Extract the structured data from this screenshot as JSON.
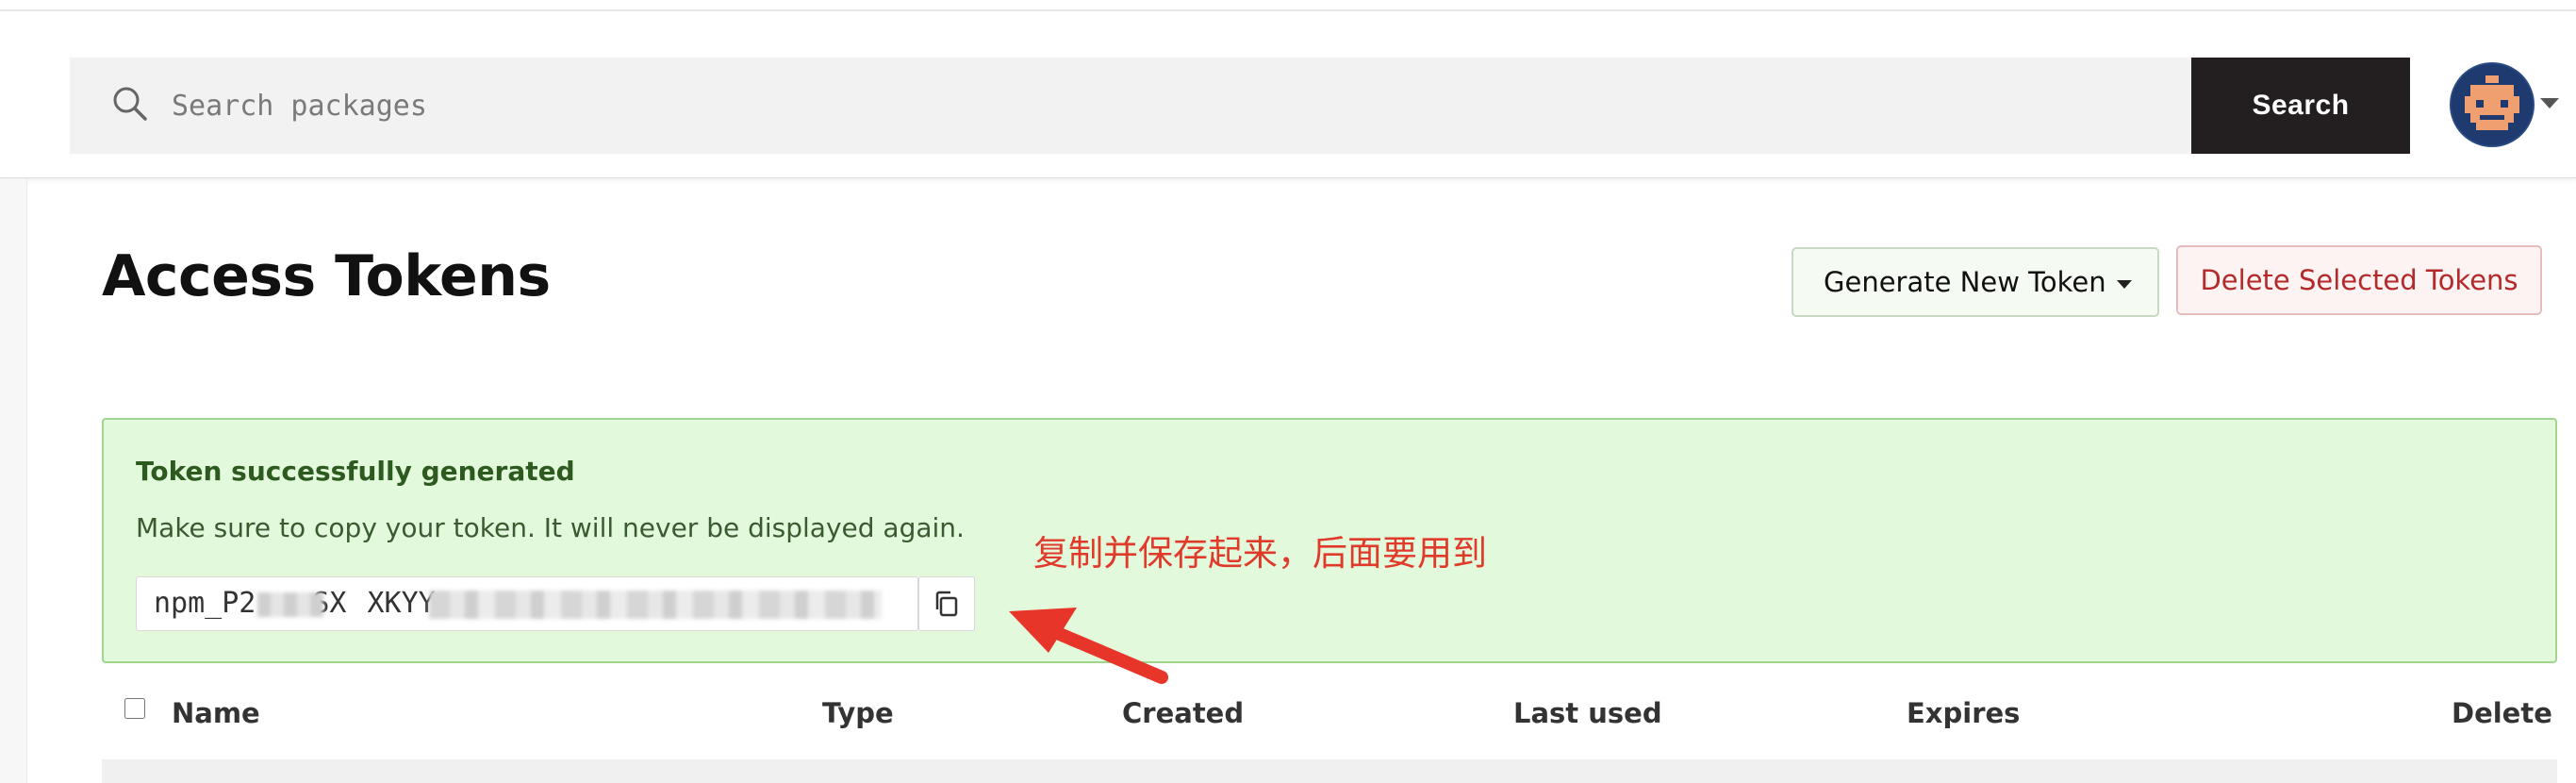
{
  "header": {
    "search": {
      "placeholder": "Search packages",
      "value": "",
      "button_label": "Search"
    }
  },
  "page": {
    "title": "Access Tokens",
    "actions": {
      "generate_label": "Generate New Token",
      "delete_selected_label": "Delete Selected Tokens"
    }
  },
  "banner": {
    "title": "Token successfully generated",
    "message": "Make sure to copy your token. It will never be displayed again.",
    "token_prefix": "npm_P2",
    "token_mid": "SX",
    "token_tail": "XKYY",
    "annotation": "复制并保存起来，后面要用到"
  },
  "table": {
    "columns": [
      "Name",
      "Type",
      "Created",
      "Last used",
      "Expires",
      "Delete"
    ]
  },
  "icons": {
    "search": "search-icon",
    "copy": "copy-icon",
    "caret": "chevron-down-icon",
    "avatar": "user-avatar"
  },
  "colors": {
    "search_button_bg": "#231f20",
    "banner_bg": "#e3f9dc",
    "banner_border": "#9fd58e",
    "banner_text": "#2d5a1e",
    "delete_text": "#b42a2a",
    "annotation": "#e03a2a"
  }
}
